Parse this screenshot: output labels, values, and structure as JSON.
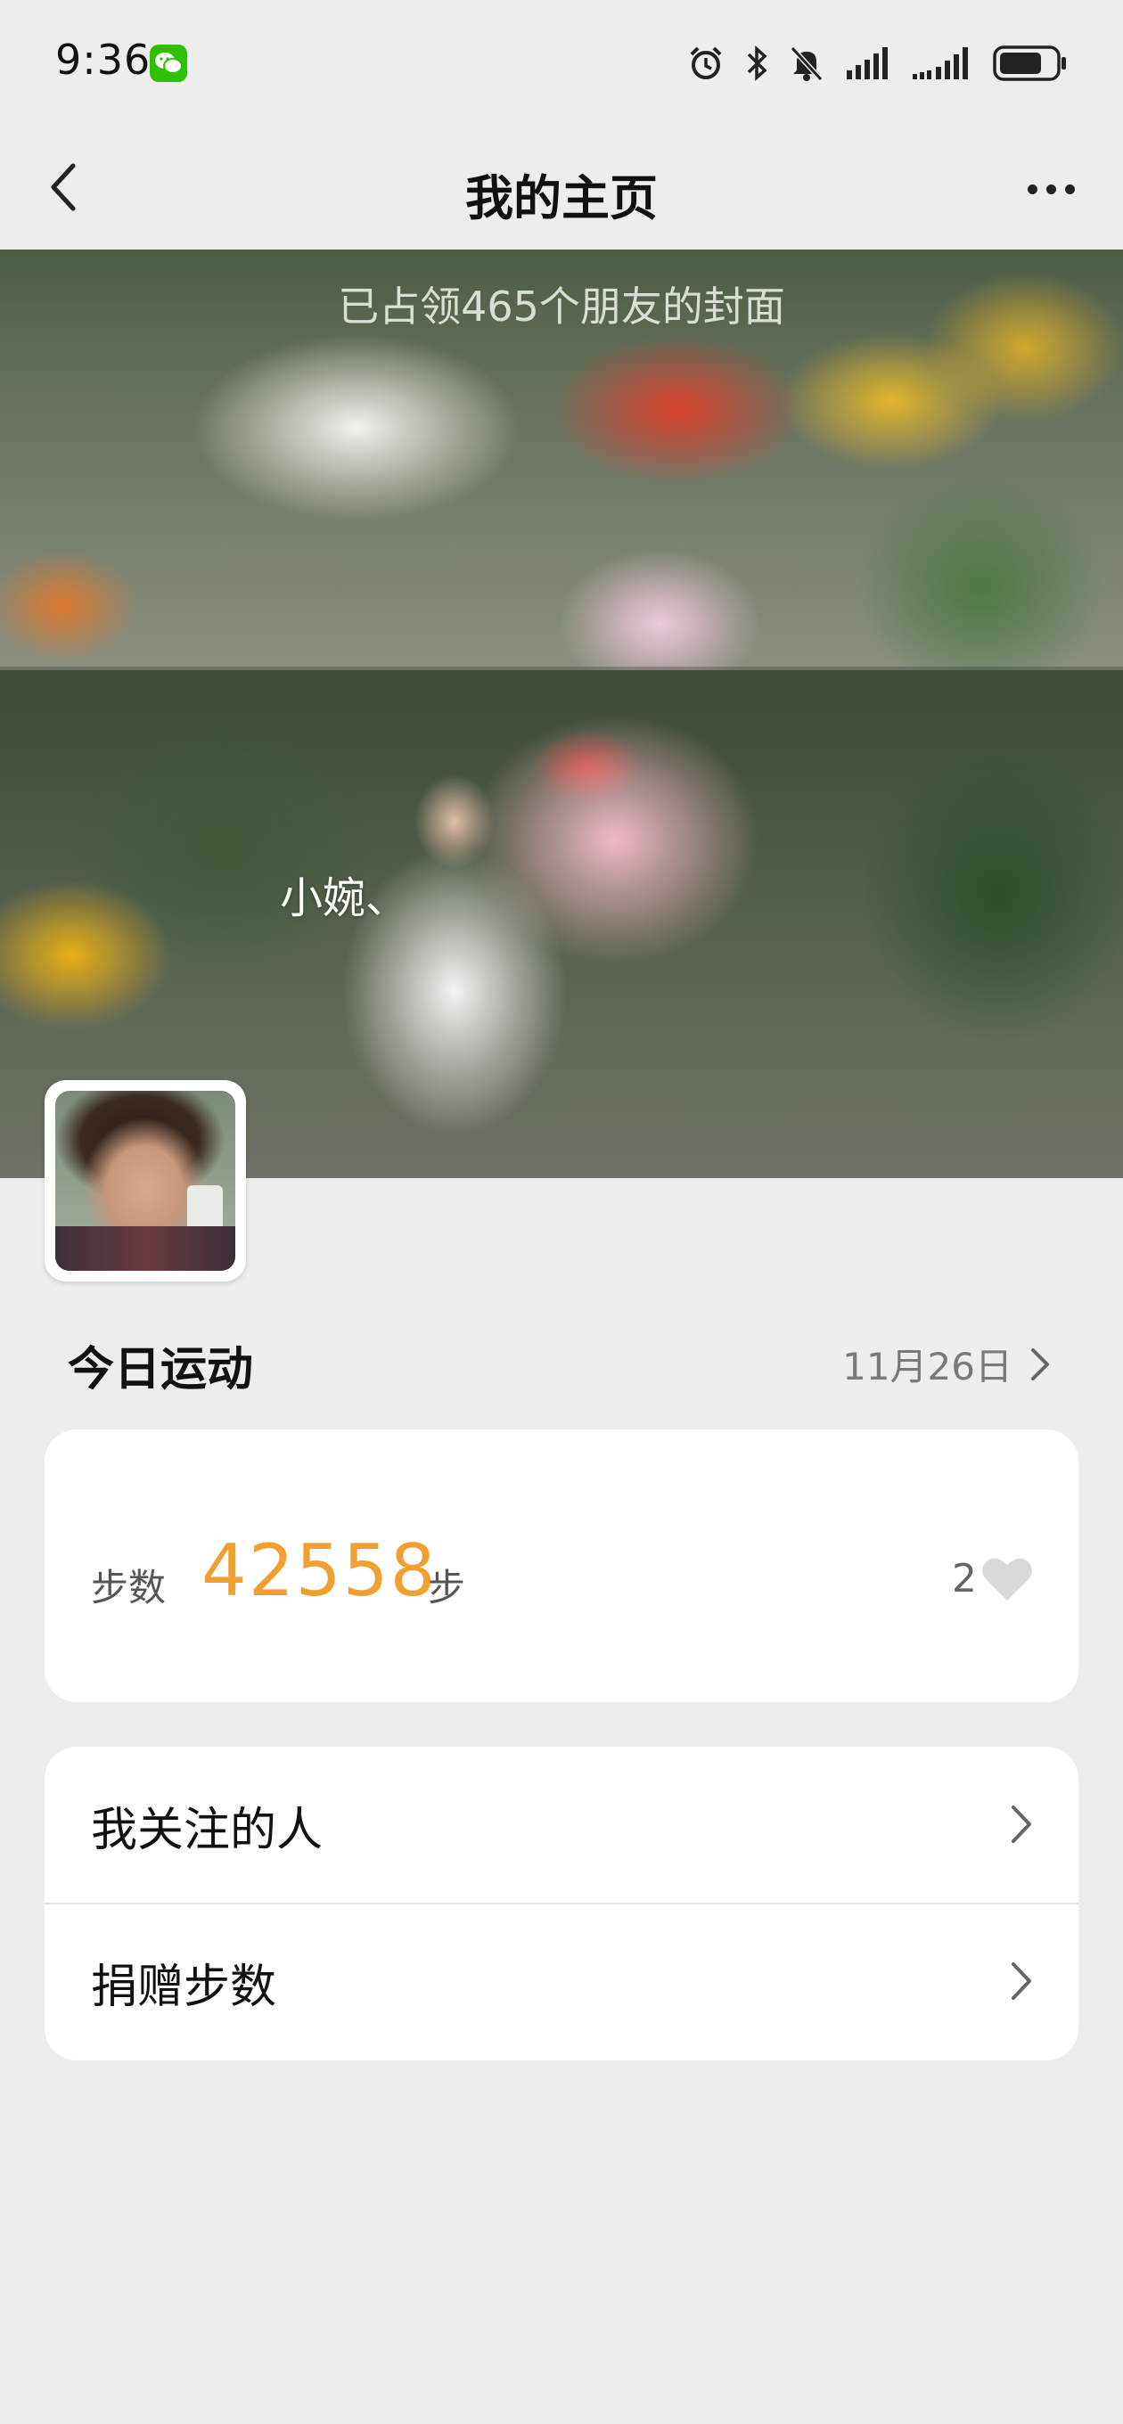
{
  "status_bar": {
    "time": "9:36",
    "icons": [
      "wechat-icon",
      "alarm-icon",
      "bluetooth-icon",
      "mute-bell-icon",
      "signal-icon",
      "signal-icon-2",
      "battery-icon"
    ]
  },
  "nav": {
    "title": "我的主页",
    "back_icon": "chevron-left-icon",
    "more_icon": "more-dots-icon"
  },
  "cover": {
    "caption": "已占领465个朋友的封面",
    "username": "小婉、"
  },
  "today": {
    "title": "今日运动",
    "date": "11月26日",
    "steps_label": "步数",
    "steps_value": "42558",
    "steps_unit": "步",
    "like_count": "2"
  },
  "menu": {
    "items": [
      {
        "label": "我关注的人"
      },
      {
        "label": "捐赠步数"
      }
    ]
  },
  "colors": {
    "background": "#ededed",
    "accent_orange": "#f0a030",
    "wechat_green": "#2dc100"
  }
}
